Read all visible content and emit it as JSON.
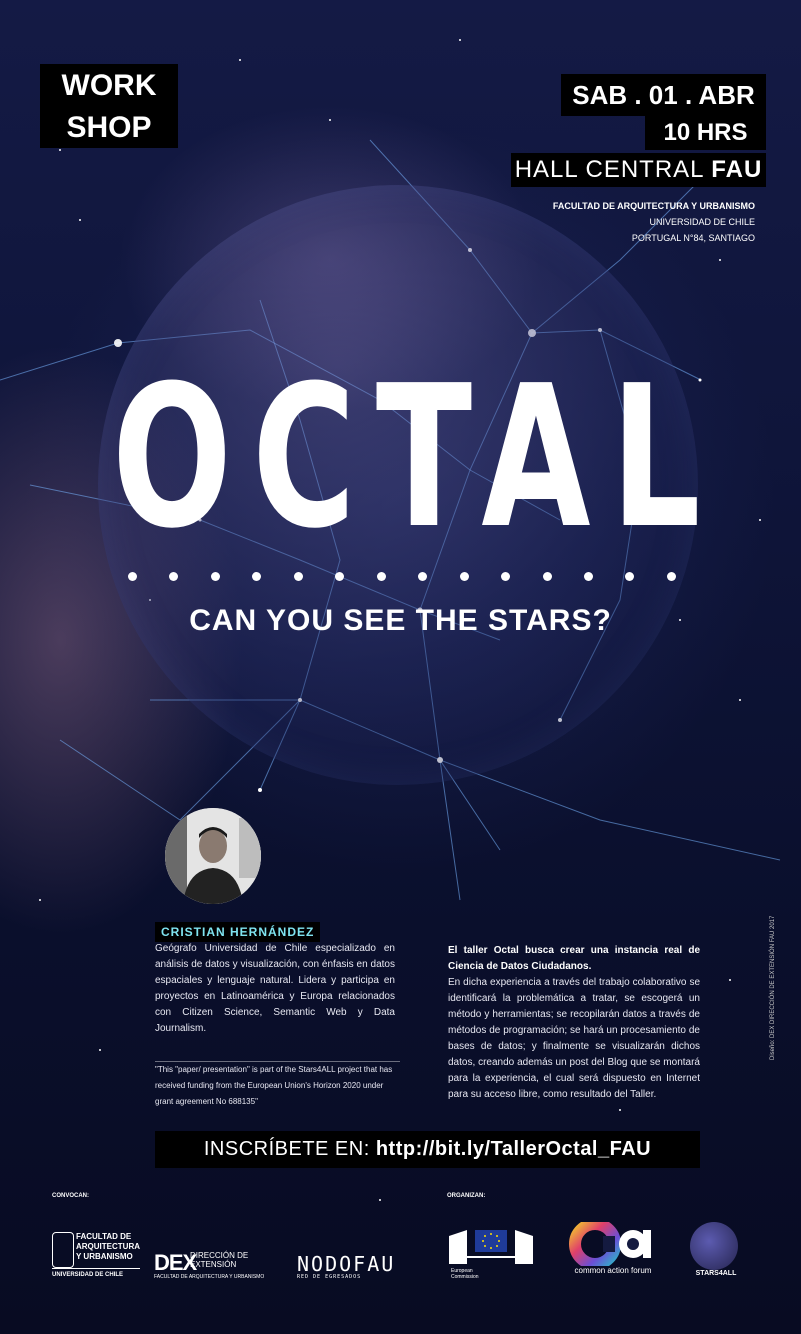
{
  "header": {
    "workshop_line1": "WORK",
    "workshop_line2": "SHOP",
    "date": "SAB . 01 . ABR",
    "time": "10 HRS",
    "venue_prefix": "HALL CENTRAL ",
    "venue_bold": "FAU",
    "address": {
      "line1": "FACULTAD DE ARQUITECTURA Y URBANISMO",
      "line2": "UNIVERSIDAD DE CHILE",
      "line3": "PORTUGAL N°84, SANTIAGO"
    }
  },
  "title": "OCTAL",
  "tagline": "CAN YOU SEE THE STARS?",
  "speaker": {
    "name": "CRISTIAN HERNÁNDEZ",
    "bio": "Geógrafo Universidad de Chile especializado en análisis de datos y visualización, con énfasis en datos espaciales y lenguaje natural. Lidera y participa en proyectos en Latinoamérica y Europa relacionados con Citizen Science, Semantic Web y Data Journalism."
  },
  "funding_note": "\"This \"paper/ presentation\" is part of the Stars4ALL project that has received funding from the European Union's Horizon 2020 under grant agreement No 688135\"",
  "description": {
    "lead": "El taller Octal busca crear una instancia real de Ciencia de Datos Ciudadanos.",
    "body": "En dicha experiencia a través del trabajo colaborativo se identificará la problemática a tratar, se escogerá un método y herramientas; se recopilarán datos a través de métodos de programación; se hará un procesamiento de bases de datos; y finalmente se visualizarán dichos datos, creando además un post del Blog que se montará para la experiencia, el cual será dispuesto en Internet para su acceso libre, como resultado del Taller."
  },
  "credit": "Diseño: DEX DIRECCIÓN DE EXTENSIÓN FAU 2017",
  "signup": {
    "prefix": "INSCRÍBETE EN: ",
    "url": "http://bit.ly/TallerOctal_FAU"
  },
  "footer": {
    "convocan_label": "CONVOCAN:",
    "organizan_label": "ORGANIZAN:",
    "fau_logo": {
      "line1": "FACULTAD DE",
      "line2": "ARQUITECTURA",
      "line3": "Y URBANISMO",
      "line4": "UNIVERSIDAD DE CHILE"
    },
    "dex_logo": {
      "big": "DEX",
      "line1": "DIRECCIÓN DE",
      "line2": "EXTENSIÓN",
      "foot": "FACULTAD DE ARQUITECTURA Y URBANISMO"
    },
    "nodo_logo": {
      "big": "NODOFAU",
      "sub": "RED DE EGRESADOS"
    },
    "ec_logo": {
      "line1": "European",
      "line2": "Commission"
    },
    "caf_logo": {
      "name": "common action forum"
    },
    "stars_logo": {
      "name": "STARS4ALL"
    }
  },
  "colors": {
    "accent_cyan": "#7fe3f0",
    "background": "#0e1438",
    "label_bg": "#000000"
  }
}
